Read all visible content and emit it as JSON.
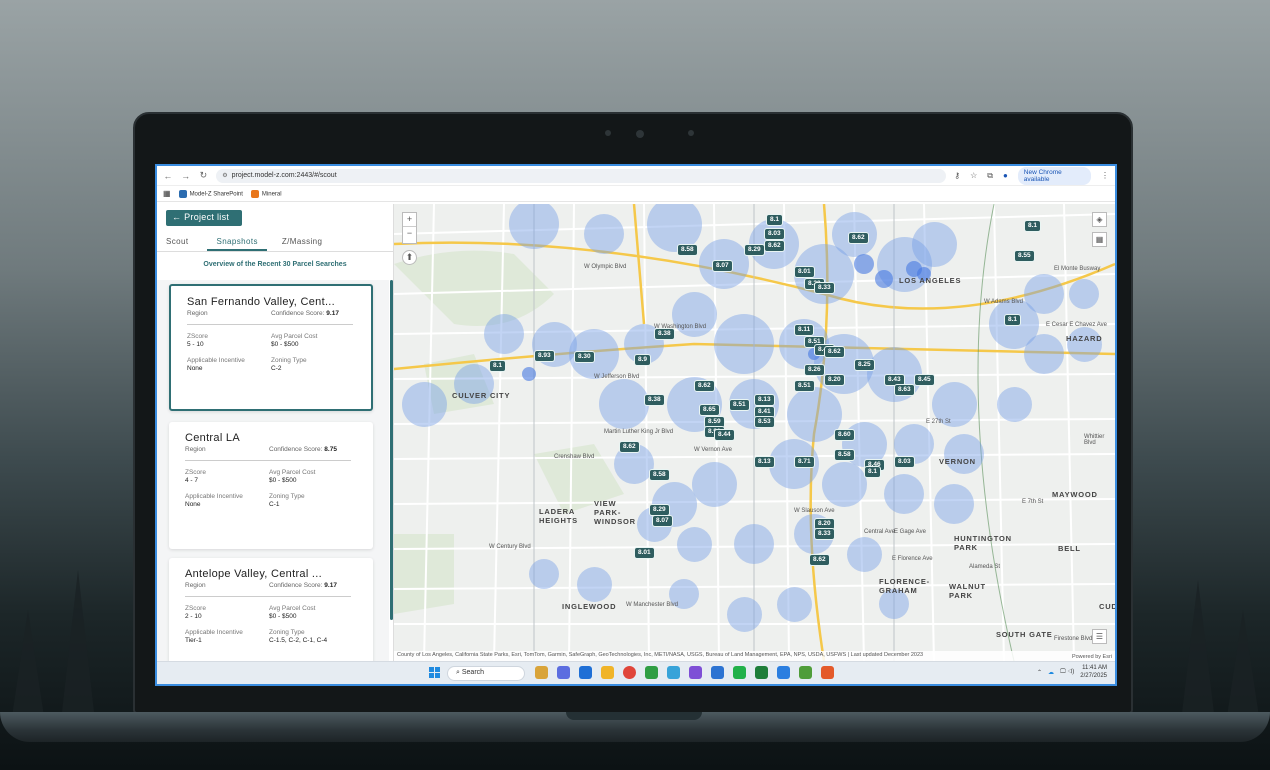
{
  "browser": {
    "url": "project.model-z.com:2443/#/scout",
    "new_chrome": "New Chrome available",
    "bookmarks": [
      {
        "label": "Model-Z SharePoint",
        "color": "#2b6cb0"
      },
      {
        "label": "Mineral",
        "color": "#e8761b"
      }
    ]
  },
  "sidebar": {
    "back_button": "← Project list",
    "tabs": [
      "Scout",
      "Snapshots",
      "Z/Massing"
    ],
    "active_tab": "Snapshots",
    "overview": "Overview of the Recent 30 Parcel Searches",
    "cards": [
      {
        "title": "San Fernando Valley, Cent...",
        "region": "Region",
        "confidence_label": "Confidence Score:",
        "confidence": "9.17",
        "zscore_label": "ZScore",
        "zscore": "5 - 10",
        "cost_label": "Avg Parcel Cost",
        "cost": "$0 - $500",
        "incentive_label": "Applicable Incentive",
        "incentive": "None",
        "zoning_label": "Zoning Type",
        "zoning": "C-2"
      },
      {
        "title": "Central LA",
        "region": "Region",
        "confidence_label": "Confidence Score:",
        "confidence": "8.75",
        "zscore_label": "ZScore",
        "zscore": "4 - 7",
        "cost_label": "Avg Parcel Cost",
        "cost": "$0 - $500",
        "incentive_label": "Applicable Incentive",
        "incentive": "None",
        "zoning_label": "Zoning Type",
        "zoning": "C-1"
      },
      {
        "title": "Antelope Valley, Central ...",
        "region": "Region",
        "confidence_label": "Confidence Score:",
        "confidence": "9.17",
        "zscore_label": "ZScore",
        "zscore": "2 - 10",
        "cost_label": "Avg Parcel Cost",
        "cost": "$0 - $500",
        "incentive_label": "Applicable Incentive",
        "incentive": "Tier-1",
        "zoning_label": "Zoning Type",
        "zoning": "C-1.5, C-2, C-1, C-4"
      }
    ]
  },
  "map": {
    "places": [
      "LOS ANGELES",
      "CULVER CITY",
      "VIEW PARK-WINDSOR",
      "LADERA HEIGHTS",
      "INGLEWOOD",
      "VERNON",
      "HUNTINGTON PARK",
      "MAYWOOD",
      "BELL",
      "FLORENCE-GRAHAM",
      "WALNUT PARK",
      "SOUTH GATE",
      "HAZARD",
      "CUD"
    ],
    "streets": [
      "W Olympic Blvd",
      "W Washington Blvd",
      "W Jefferson Blvd",
      "W Adams Blvd",
      "W Vernon Ave",
      "W Slauson Ave",
      "W Century Blvd",
      "W Manchester Blvd",
      "E Florence Ave",
      "E Gage Ave",
      "E 27th St",
      "E 7th St",
      "E Cesar E Chavez Ave",
      "El Monte Busway",
      "Firestone Blvd",
      "Martin Luther King Jr Blvd",
      "Crenshaw Blvd",
      "Central Ave",
      "Alameda St",
      "Whittier Blvd"
    ],
    "pins": [
      "8.1",
      "8.03",
      "8.62",
      "8.58",
      "8.29",
      "8.07",
      "8.01",
      "8.20",
      "8.33",
      "8.62",
      "8.1",
      "8.55",
      "8.11",
      "8.51",
      "8.42",
      "8.62",
      "8.25",
      "8.26",
      "8.51",
      "8.20",
      "8.43",
      "8.45",
      "8.63",
      "8.9",
      "8.38",
      "8.30",
      "8.93",
      "8.1",
      "8.38",
      "8.62",
      "8.51",
      "8.65",
      "8.59",
      "8.91",
      "8.13",
      "8.41",
      "8.53",
      "8.44",
      "8.60",
      "8.13",
      "8.71",
      "8.58",
      "8.46"
    ],
    "attribution": "County of Los Angeles, California State Parks, Esri, TomTom, Garmin, SafeGraph, GeoTechnologies, Inc, METI/NASA, USGS, Bureau of Land Management, EPA, NPS, USDA, USFWS | Last updated December 2023",
    "powered_by": "Powered by Esri",
    "zoom_in": "+",
    "zoom_out": "−"
  },
  "taskbar": {
    "search": "Search",
    "time": "11:41 AM",
    "date": "2/27/2025",
    "app_colors": [
      "#d9a43a",
      "#5b6de0",
      "#1f6fd6",
      "#f0b429",
      "#e0453a",
      "#2f9e44",
      "#37a3d9",
      "#7e4fd6",
      "#2c73d2",
      "#21b14a",
      "#1e7e3a",
      "#2b7ee0",
      "#4f9d3a",
      "#e45a2a"
    ]
  }
}
